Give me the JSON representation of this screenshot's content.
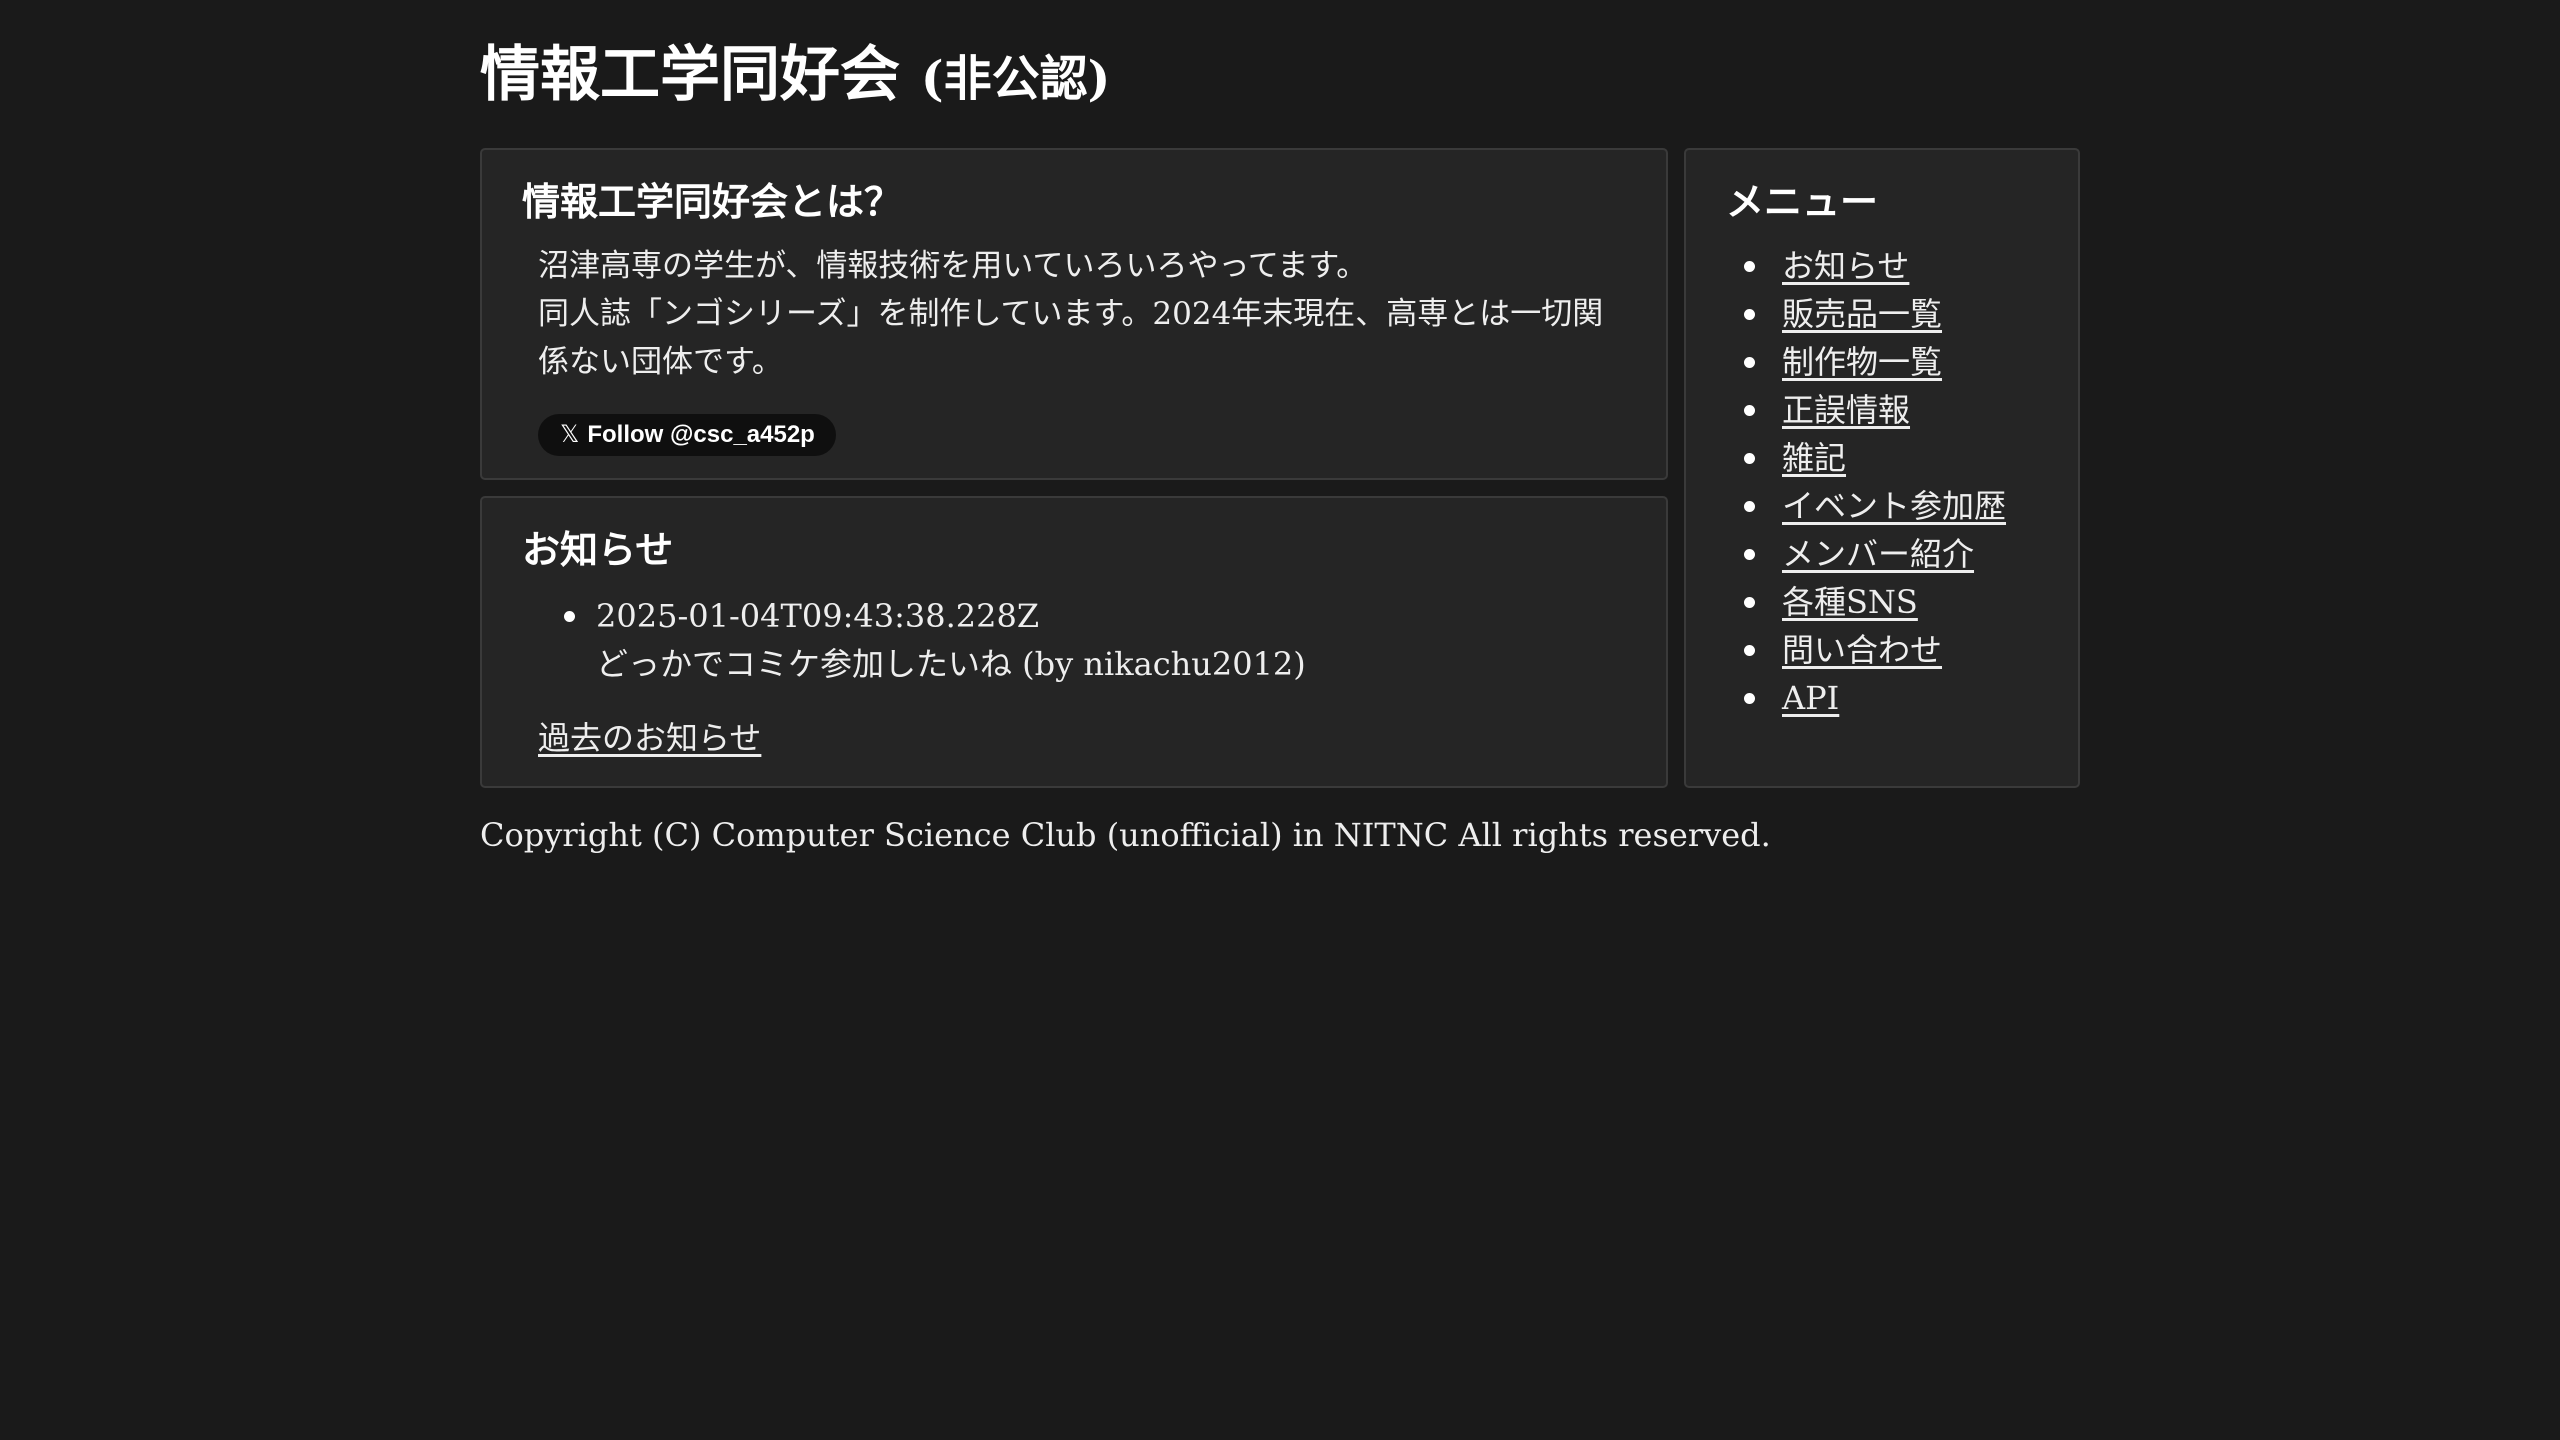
{
  "site": {
    "title": "情報工学同好会",
    "subtitle": "(非公認)"
  },
  "about": {
    "heading": "情報工学同好会とは？",
    "line1": "沼津高専の学生が、情報技術を用いていろいろやってます。",
    "line2": "同人誌「ンゴシリーズ」を制作しています。2024年末現在、高専とは一切関係ない団体です。",
    "follow_label": "Follow @csc_a452p",
    "follow_icon": "x-logo-icon"
  },
  "news": {
    "heading": "お知らせ",
    "items": [
      {
        "timestamp": "2025-01-04T09:43:38.228Z",
        "message": "どっかでコミケ参加したいね (by nikachu2012)"
      }
    ],
    "past_link": "過去のお知らせ"
  },
  "menu": {
    "heading": "メニュー",
    "items": [
      {
        "label": "お知らせ"
      },
      {
        "label": "販売品一覧"
      },
      {
        "label": "制作物一覧"
      },
      {
        "label": "正誤情報"
      },
      {
        "label": "雑記"
      },
      {
        "label": "イベント参加歴"
      },
      {
        "label": "メンバー紹介"
      },
      {
        "label": "各種SNS"
      },
      {
        "label": "問い合わせ"
      },
      {
        "label": "API"
      }
    ]
  },
  "footer": {
    "copyright": "Copyright (C) Computer Science Club (unofficial) in NITNC All rights reserved."
  },
  "colors": {
    "background": "#1a1a1a",
    "panel": "#252525",
    "border": "#3a3a3a",
    "text": "#f2f2f2"
  }
}
